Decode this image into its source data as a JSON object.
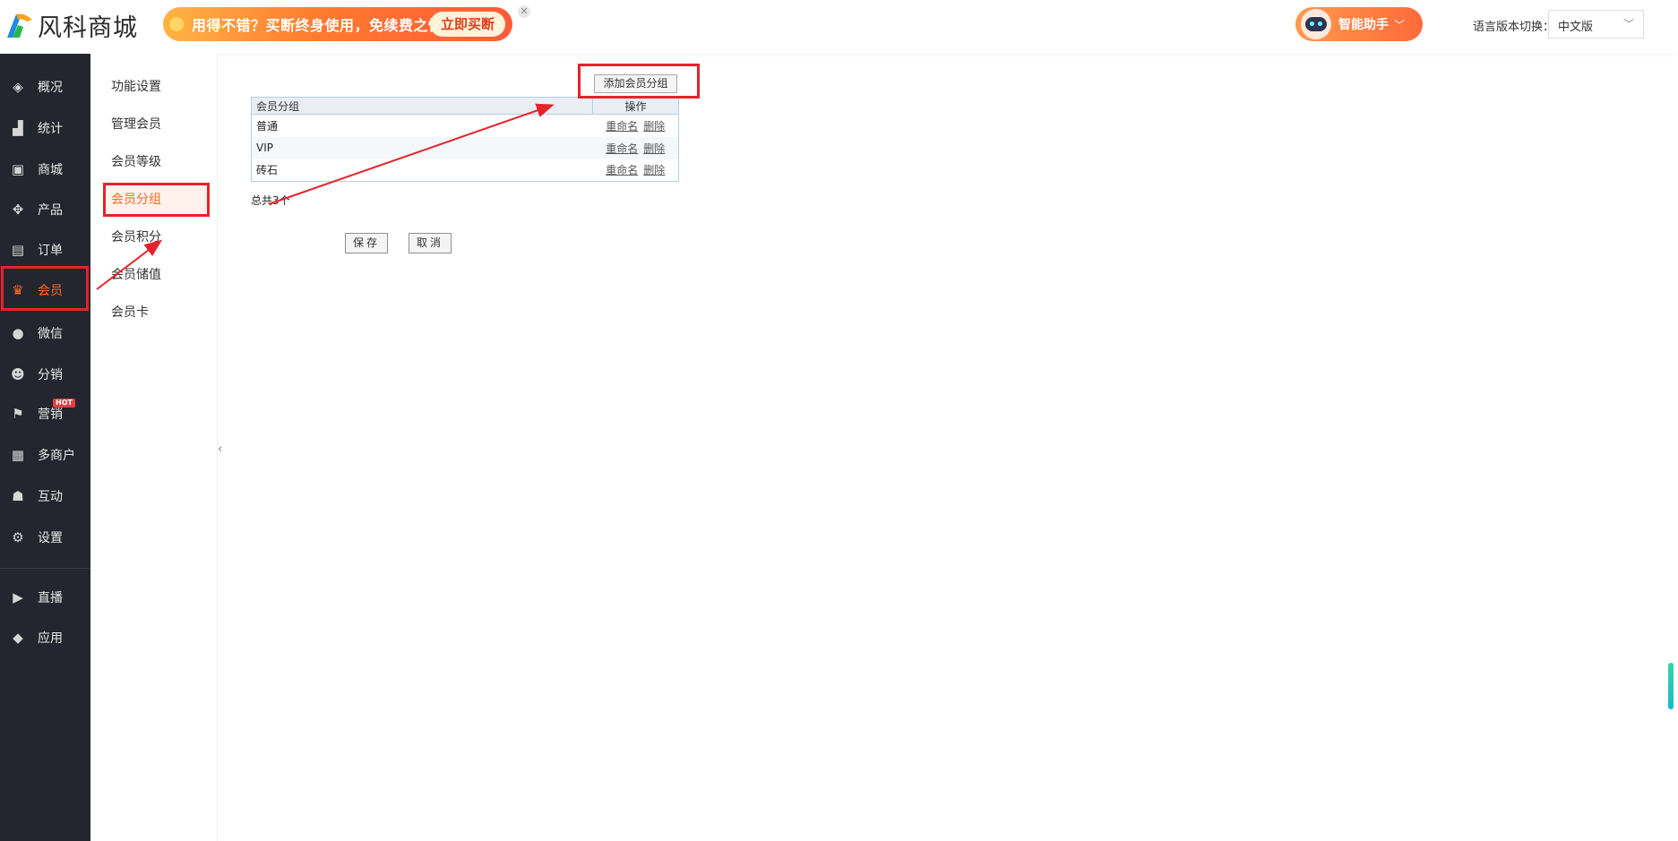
{
  "header": {
    "logo_text": "风科商城",
    "promo_text": "用得不错？买断终身使用，免续费之忧！",
    "promo_button": "立即买断",
    "promo_close": "✕",
    "assistant_label": "智能助手",
    "assistant_chevron": "﹀",
    "lang_label": "语言版本切换：",
    "lang_value": "中文版",
    "lang_chevron": "﹀"
  },
  "sidebar": {
    "items": [
      {
        "label": "概况",
        "icon": "layers-icon",
        "glyph": "◈"
      },
      {
        "label": "统计",
        "icon": "chart-icon",
        "glyph": "▟"
      },
      {
        "label": "商城",
        "icon": "shop-icon",
        "glyph": "▣"
      },
      {
        "label": "产品",
        "icon": "grid-icon",
        "glyph": "✥"
      },
      {
        "label": "订单",
        "icon": "order-icon",
        "glyph": "▤"
      },
      {
        "label": "会员",
        "icon": "crown-icon",
        "glyph": "♛"
      },
      {
        "label": "微信",
        "icon": "wechat-icon",
        "glyph": "●"
      },
      {
        "label": "分销",
        "icon": "user-icon",
        "glyph": "☻"
      },
      {
        "label": "营销",
        "icon": "flag-icon",
        "glyph": "⚑",
        "badge": "HOT"
      },
      {
        "label": "多商户",
        "icon": "merchant-icon",
        "glyph": "▦"
      },
      {
        "label": "互动",
        "icon": "interact-icon",
        "glyph": "☗"
      },
      {
        "label": "设置",
        "icon": "gear-icon",
        "glyph": "⚙"
      },
      {
        "label": "直播",
        "icon": "live-icon",
        "glyph": "▶"
      },
      {
        "label": "应用",
        "icon": "apps-icon",
        "glyph": "◆"
      }
    ],
    "active_index": 5
  },
  "subnav": {
    "items": [
      "功能设置",
      "管理会员",
      "会员等级",
      "会员分组",
      "会员积分",
      "会员储值",
      "会员卡"
    ],
    "active_index": 3,
    "collapse_glyph": "‹"
  },
  "content": {
    "add_button": "添加会员分组",
    "table": {
      "col_group": "会员分组",
      "col_ops": "操作",
      "rows": [
        {
          "name": "普通",
          "rename": "重命名",
          "delete": "删除"
        },
        {
          "name": "VIP",
          "rename": "重命名",
          "delete": "删除"
        },
        {
          "name": "砖石",
          "rename": "重命名",
          "delete": "删除"
        }
      ]
    },
    "total_prefix": "总共",
    "total_count": "3",
    "total_suffix": "个",
    "save_button": "保存",
    "cancel_button": "取消"
  },
  "colors": {
    "accent": "#ff6a25",
    "sidebar_bg": "#23262e",
    "annotation_red": "#e5232b"
  }
}
